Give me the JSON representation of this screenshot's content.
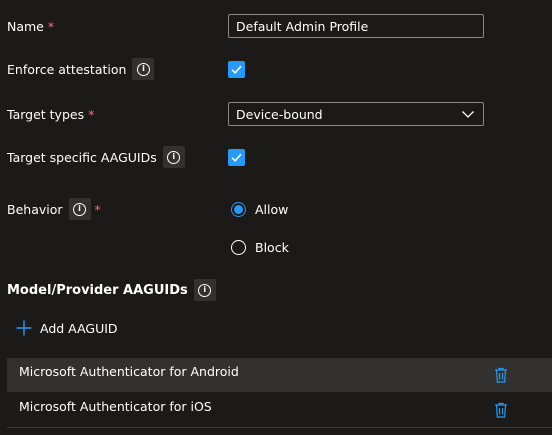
{
  "form": {
    "name": {
      "label": "Name",
      "required": "*",
      "value": "Default Admin Profile"
    },
    "enforce_attestation": {
      "label": "Enforce attestation",
      "checked": true
    },
    "target_types": {
      "label": "Target types",
      "required": "*",
      "value": "Device-bound"
    },
    "target_specific_aaguids": {
      "label": "Target specific AAGUIDs",
      "checked": true
    },
    "behavior": {
      "label": "Behavior",
      "required": "*",
      "options": [
        "Allow",
        "Block"
      ],
      "selected": "Allow"
    }
  },
  "aaguids": {
    "title": "Model/Provider AAGUIDs",
    "add_label": "Add AAGUID",
    "items": [
      {
        "name": "Microsoft Authenticator for Android"
      },
      {
        "name": "Microsoft Authenticator for iOS"
      }
    ]
  },
  "colors": {
    "background": "#1b1a19",
    "accent": "#2899f5",
    "required": "#f1707b",
    "row_highlight": "#323130"
  },
  "icons": [
    "info-icon",
    "checkmark-icon",
    "chevron-down-icon",
    "add-icon",
    "delete-icon"
  ]
}
